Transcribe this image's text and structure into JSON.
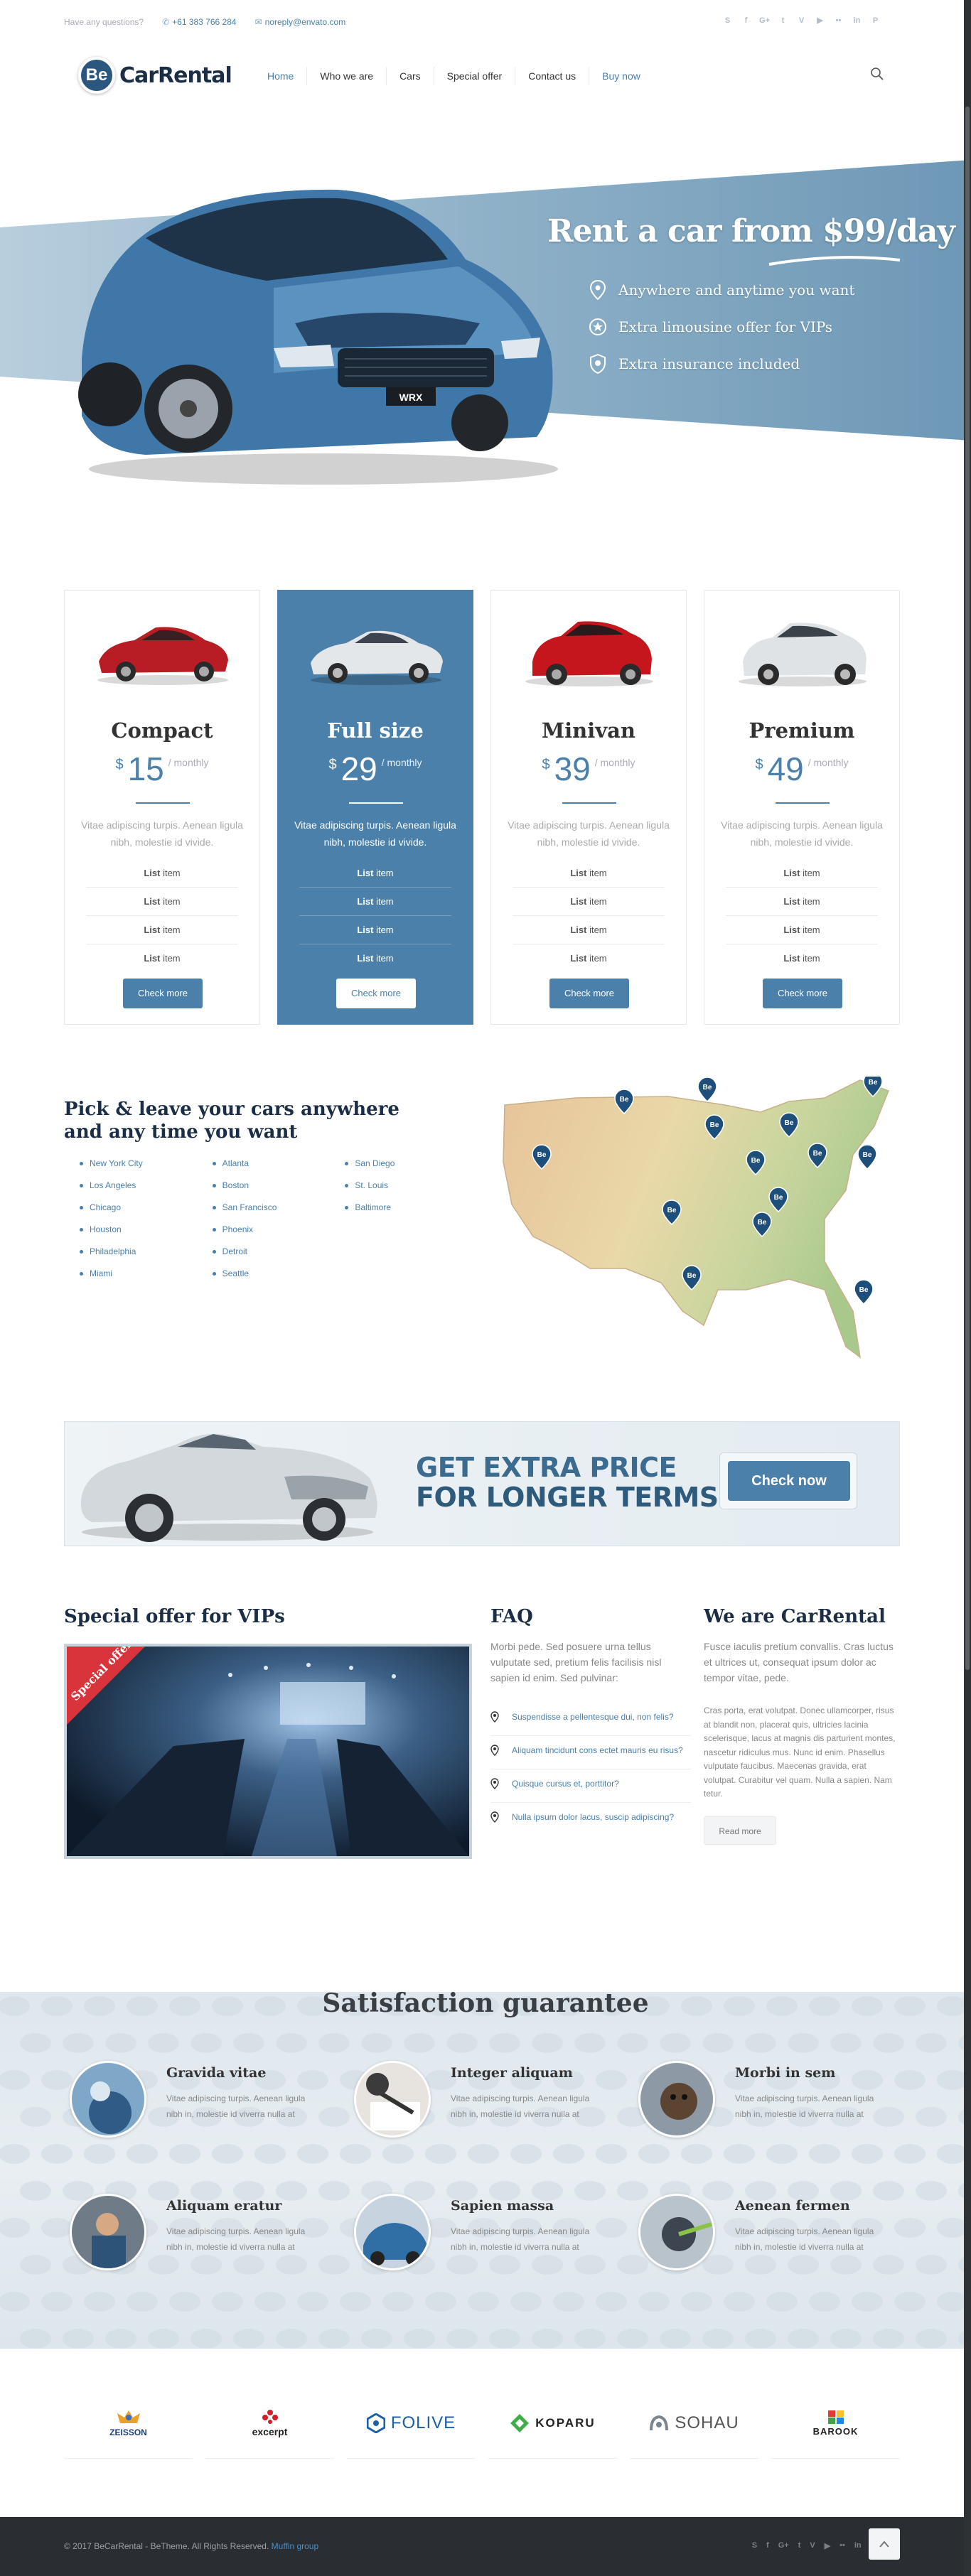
{
  "topbar": {
    "question": "Have any questions?",
    "phone": "+61 383 766 284",
    "email": "noreply@envato.com",
    "social_icons": [
      "skype-icon",
      "facebook-icon",
      "google-plus-icon",
      "twitter-icon",
      "vimeo-icon",
      "youtube-icon",
      "flickr-icon",
      "linkedin-icon",
      "pinterest-icon"
    ]
  },
  "header": {
    "logo_mark": "Be",
    "logo_text": "CarRental",
    "nav": [
      "Home",
      "Who we are",
      "Cars",
      "Special offer",
      "Contact us",
      "Buy now"
    ]
  },
  "hero": {
    "title": "Rent a car from $99/day",
    "features": [
      "Anywhere and anytime you want",
      "Extra limousine offer for VIPs",
      "Extra insurance included"
    ],
    "car_badge": "WRX",
    "colors": {
      "band": "#7ca3bd",
      "accent": "#4a80aa"
    }
  },
  "pricing": [
    {
      "name": "Compact",
      "currency": "$",
      "amount": "15",
      "period": "/ monthly",
      "desc": "Vitae adipiscing turpis. Aenean ligula nibh, molestie id vivide.",
      "items": [
        "List",
        "List",
        "List",
        "List"
      ],
      "item_suffix": " item",
      "button": "Check more",
      "car_color": "#b81d24"
    },
    {
      "name": "Full size",
      "currency": "$",
      "amount": "29",
      "period": "/ monthly",
      "desc": "Vitae adipiscing turpis. Aenean ligula nibh, molestie id vivide.",
      "items": [
        "List",
        "List",
        "List",
        "List"
      ],
      "item_suffix": " item",
      "button": "Check more",
      "car_color": "#e4e7ea"
    },
    {
      "name": "Minivan",
      "currency": "$",
      "amount": "39",
      "period": "/ monthly",
      "desc": "Vitae adipiscing turpis. Aenean ligula nibh, molestie id vivide.",
      "items": [
        "List",
        "List",
        "List",
        "List"
      ],
      "item_suffix": " item",
      "button": "Check more",
      "car_color": "#c4161c"
    },
    {
      "name": "Premium",
      "currency": "$",
      "amount": "49",
      "period": "/ monthly",
      "desc": "Vitae adipiscing turpis. Aenean ligula nibh, molestie id vivide.",
      "items": [
        "List",
        "List",
        "List",
        "List"
      ],
      "item_suffix": " item",
      "button": "Check more",
      "car_color": "#dfe3e6"
    }
  ],
  "locations": {
    "title_line1": "Pick & leave your cars anywhere",
    "title_line2": "and any time you want",
    "columns": [
      [
        "New York City",
        "Los Angeles",
        "Chicago",
        "Houston",
        "Philadelphia",
        "Miami"
      ],
      [
        "Atlanta",
        "Boston",
        "San Francisco",
        "Phoenix",
        "Detroit",
        "Seattle"
      ],
      [
        "San Diego",
        "St. Louis",
        "Baltimore"
      ]
    ],
    "pin_label": "Be"
  },
  "banner": {
    "line1": "GET EXTRA PRICE",
    "line2": "FOR LONGER TERMS",
    "button": "Check now"
  },
  "vip": {
    "title": "Special offer for VIPs",
    "ribbon": "Special offer"
  },
  "faq": {
    "title": "FAQ",
    "intro": "Morbi pede. Sed posuere urna tellus vulputate sed, pretium felis facilisis nisl sapien id enim. Sed pulvinar:",
    "items": [
      "Suspendisse a pellentesque dui, non felis?",
      "Aliquam tincidunt cons ectet mauris eu risus?",
      "Quisque cursus et, porttitor?",
      "Nulla ipsum dolor lacus, suscip adipiscing?"
    ]
  },
  "about": {
    "title": "We are CarRental",
    "lead": "Fusce iaculis pretium convallis. Cras luctus et ultrices ut, consequat ipsum dolor ac tempor vitae, pede.",
    "body": "Cras porta, erat volutpat. Donec ullamcorper, risus at blandit non, placerat quis, ultricies lacinia scelerisque, lacus at magnis dis parturient montes, nascetur ridiculus mus. Nunc id enim. Phasellus vulputate faucibus. Maecenas gravida, erat volutpat. Curabitur vel quam. Nulla a sapien. Nam tetur.",
    "button": "Read more"
  },
  "satisfaction": {
    "title": "Satisfaction guarantee",
    "features": [
      {
        "title": "Gravida vitae",
        "desc": "Vitae adipiscing turpis. Aenean ligula nibh in, molestie id viverra nulla at"
      },
      {
        "title": "Integer aliquam",
        "desc": "Vitae adipiscing turpis. Aenean ligula nibh in, molestie id viverra nulla at"
      },
      {
        "title": "Morbi in sem",
        "desc": "Vitae adipiscing turpis. Aenean ligula nibh in, molestie id viverra nulla at"
      },
      {
        "title": "Aliquam eratur",
        "desc": "Vitae adipiscing turpis. Aenean ligula nibh in, molestie id viverra nulla at"
      },
      {
        "title": "Sapien massa",
        "desc": "Vitae adipiscing turpis. Aenean ligula nibh in, molestie id viverra nulla at"
      },
      {
        "title": "Aenean fermen",
        "desc": "Vitae adipiscing turpis. Aenean ligula nibh in, molestie id viverra nulla at"
      }
    ]
  },
  "clients": [
    "ZEISSON",
    "excerpt",
    "FOLIVE",
    "KOPARU",
    "SOHAU",
    "BAROOK"
  ],
  "footer": {
    "copyright": "© 2017 BeCarRental - BeTheme. All Rights Reserved.",
    "company": "Muffin group"
  }
}
